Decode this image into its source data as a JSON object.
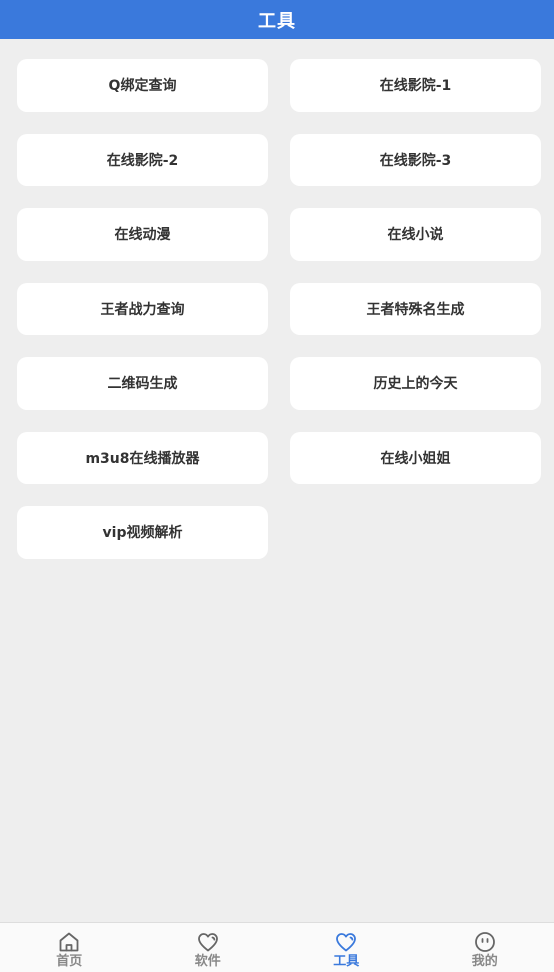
{
  "header": {
    "title": "工具"
  },
  "tools": [
    {
      "label": "Q绑定查询"
    },
    {
      "label": "在线影院-1"
    },
    {
      "label": "在线影院-2"
    },
    {
      "label": "在线影院-3"
    },
    {
      "label": "在线动漫"
    },
    {
      "label": "在线小说"
    },
    {
      "label": "王者战力查询"
    },
    {
      "label": "王者特殊名生成"
    },
    {
      "label": "二维码生成"
    },
    {
      "label": "历史上的今天"
    },
    {
      "label": "m3u8在线播放器"
    },
    {
      "label": "在线小姐姐"
    },
    {
      "label": "vip视频解析"
    }
  ],
  "tabbar": {
    "items": [
      {
        "label": "首页",
        "icon": "home-icon",
        "active": false
      },
      {
        "label": "软件",
        "icon": "heart-icon",
        "active": false
      },
      {
        "label": "工具",
        "icon": "heart-icon",
        "active": true
      },
      {
        "label": "我的",
        "icon": "face-icon",
        "active": false
      }
    ]
  },
  "colors": {
    "accent": "#3a79dc",
    "background": "#eeeeee",
    "card": "#ffffff",
    "inactive": "#888888"
  }
}
